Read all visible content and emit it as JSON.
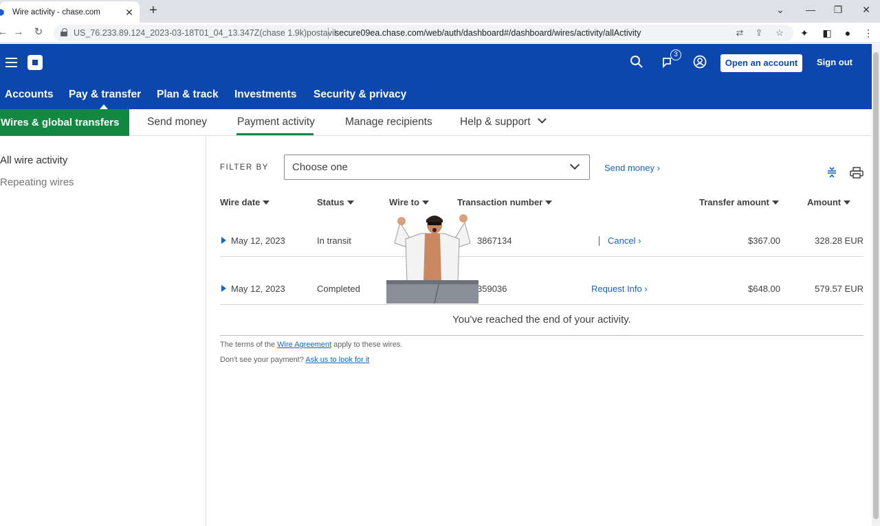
{
  "browser": {
    "tab_title": "Wire activity - chase.com",
    "url_hint": "US_76.233.89.124_2023-03-18T01_04_13.347Z(chase 1.9k)postavil",
    "url": "secure09ea.chase.com/web/auth/dashboard#/dashboard/wires/activity/allActivity"
  },
  "header": {
    "notification_count": "3",
    "open_account_label": "Open an account",
    "sign_out_label": "Sign out",
    "nav": [
      "Accounts",
      "Pay & transfer",
      "Plan & track",
      "Investments",
      "Security & privacy"
    ]
  },
  "subnav": {
    "active": "Wires & global transfers",
    "items": [
      "Send money",
      "Payment activity",
      "Manage recipients",
      "Help & support"
    ]
  },
  "sidebar": {
    "items": [
      "All wire activity",
      "Repeating wires"
    ]
  },
  "filter": {
    "label": "FILTER BY",
    "value": "Choose one",
    "send_money_link": "Send money"
  },
  "table": {
    "headers": [
      "Wire date",
      "Status",
      "Wire to",
      "Transaction number",
      "Transfer amount",
      "Amount"
    ],
    "rows": [
      {
        "date": "May 12, 2023",
        "status": "In transit",
        "transaction": "3867134",
        "action": "Cancel",
        "transfer_amount": "$367.00",
        "amount": "328.28 EUR"
      },
      {
        "date": "May 12, 2023",
        "status": "Completed",
        "transaction": "359036",
        "action": "Request Info",
        "transfer_amount": "$648.00",
        "amount": "579.57 EUR"
      }
    ],
    "end_message": "You've reached the end of your activity."
  },
  "footer": {
    "terms_prefix": "The terms of the",
    "terms_link": "Wire Agreement",
    "terms_suffix": "apply to these wires.",
    "missing_prefix": "Don't see your payment?",
    "missing_link": "Ask us to look for it"
  },
  "colors": {
    "chase_blue": "#0c47b0",
    "active_green": "#128842",
    "link_blue": "#1565c0"
  }
}
